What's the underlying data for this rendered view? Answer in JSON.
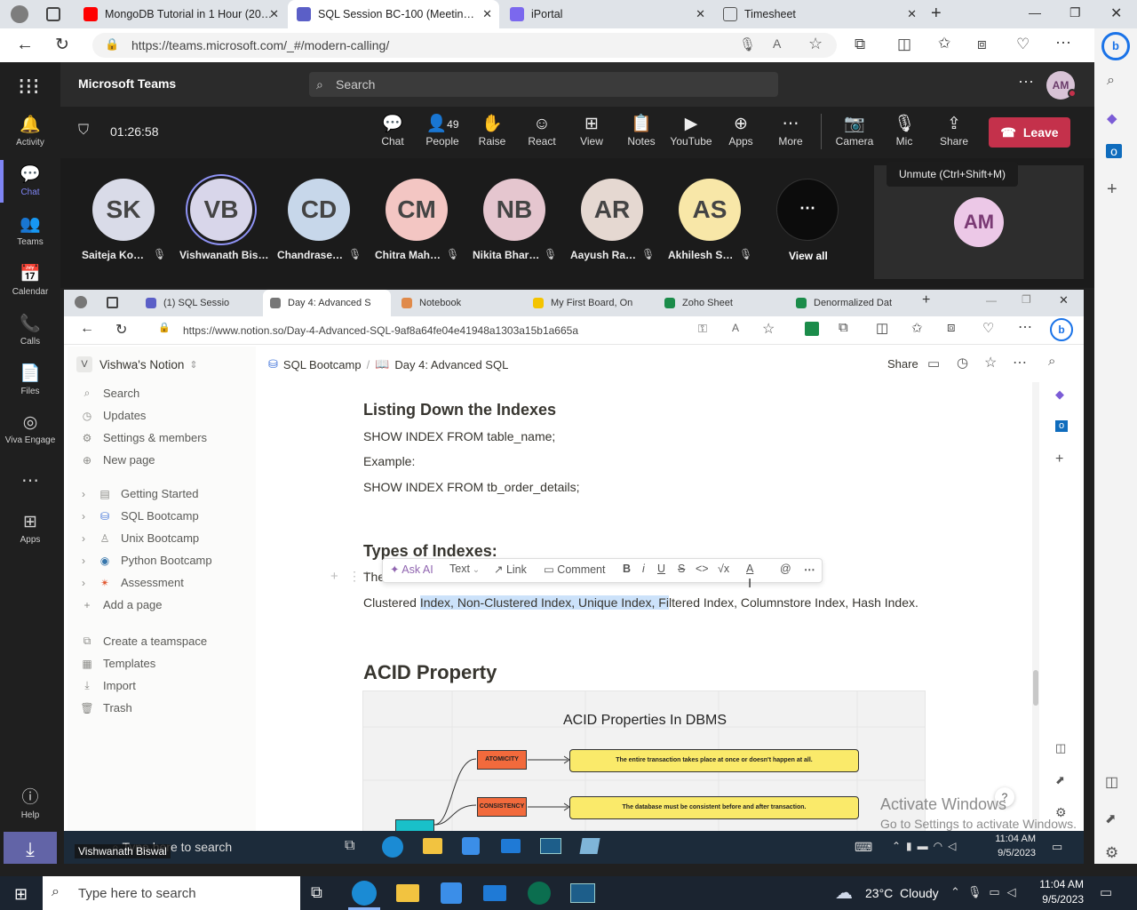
{
  "outer_browser": {
    "tabs": [
      {
        "title": "MongoDB Tutorial in 1 Hour (20…",
        "icon": "youtube-icon",
        "color": "#ff0000"
      },
      {
        "title": "SQL Session BC-100 (Meetin…",
        "icon": "teams-icon",
        "color": "#5b5fc7"
      },
      {
        "title": "iPortal",
        "icon": "portal-icon",
        "color": "#7b68ee"
      },
      {
        "title": "Timesheet",
        "icon": "page-icon",
        "color": "#666666"
      }
    ],
    "url": "https://teams.microsoft.com/_#/modern-calling/"
  },
  "teams": {
    "app_name": "Microsoft Teams",
    "search_placeholder": "Search",
    "avatar": "AM",
    "rail": [
      {
        "label": "Activity",
        "icon": "bell-icon"
      },
      {
        "label": "Chat",
        "icon": "chat-icon"
      },
      {
        "label": "Teams",
        "icon": "teams-icon"
      },
      {
        "label": "Calendar",
        "icon": "calendar-icon"
      },
      {
        "label": "Calls",
        "icon": "phone-icon"
      },
      {
        "label": "Files",
        "icon": "file-icon"
      },
      {
        "label": "Viva Engage",
        "icon": "viva-icon"
      },
      {
        "label": "Apps",
        "icon": "apps-icon"
      },
      {
        "label": "Help",
        "icon": "help-icon"
      }
    ],
    "timer": "01:26:58",
    "meeting_buttons": [
      {
        "label": "Chat",
        "icon": "chat-icon",
        "glyph": "💬"
      },
      {
        "label": "People",
        "icon": "people-icon",
        "glyph": "👤",
        "count": "49"
      },
      {
        "label": "Raise",
        "icon": "hand-icon",
        "glyph": "✋"
      },
      {
        "label": "React",
        "icon": "smile-icon",
        "glyph": "☺"
      },
      {
        "label": "View",
        "icon": "grid-icon",
        "glyph": "⊞"
      },
      {
        "label": "Notes",
        "icon": "notes-icon",
        "glyph": "📋"
      },
      {
        "label": "YouTube",
        "icon": "youtube-icon",
        "glyph": "▶"
      },
      {
        "label": "Apps",
        "icon": "plus-icon",
        "glyph": "⊕"
      },
      {
        "label": "More",
        "icon": "more-icon",
        "glyph": "⋯"
      },
      {
        "label": "Camera",
        "icon": "camera-off-icon",
        "glyph": "📷"
      },
      {
        "label": "Mic",
        "icon": "mic-off-icon",
        "glyph": "🎙"
      },
      {
        "label": "Share",
        "icon": "share-icon",
        "glyph": "⇪"
      }
    ],
    "leave_label": "Leave",
    "unmute_tooltip": "Unmute (Ctrl+Shift+M)",
    "participants": [
      {
        "initials": "SK",
        "name": "Saiteja Ko…",
        "color": "#d9dbe8"
      },
      {
        "initials": "VB",
        "name": "Vishwanath Bis…",
        "color": "#d8d6ea"
      },
      {
        "initials": "CD",
        "name": "Chandrase…",
        "color": "#c7d7ea"
      },
      {
        "initials": "CM",
        "name": "Chitra Mah…",
        "color": "#f3c6c3"
      },
      {
        "initials": "NB",
        "name": "Nikita Bhar…",
        "color": "#e5c6cf"
      },
      {
        "initials": "AR",
        "name": "Aayush Ra…",
        "color": "#e5d8d1"
      },
      {
        "initials": "AS",
        "name": "Akhilesh S…",
        "color": "#f8e7a8"
      }
    ],
    "view_all": "View all",
    "self_initials": "AM"
  },
  "inner_browser": {
    "tabs": [
      {
        "title": "(1) SQL Sessio",
        "color": "#5b5fc7"
      },
      {
        "title": "Day 4: Advanced S",
        "color": "#777777"
      },
      {
        "title": "Notebook",
        "color": "#e08a4a"
      },
      {
        "title": "My First Board, On",
        "color": "#f4c400"
      },
      {
        "title": "Zoho Sheet",
        "color": "#1b8c4a"
      },
      {
        "title": "Denormalized Dat",
        "color": "#1b8c4a"
      }
    ],
    "url": "https://www.notion.so/Day-4-Advanced-SQL-9af8a64fe04e41948a1303a15b1a665a"
  },
  "notion": {
    "workspace_initial": "V",
    "workspace": "Vishwa's Notion",
    "nav": [
      {
        "label": "Search",
        "icon": "search-icon",
        "glyph": "⌕"
      },
      {
        "label": "Updates",
        "icon": "clock-icon",
        "glyph": "◷"
      },
      {
        "label": "Settings & members",
        "icon": "gear-icon",
        "glyph": "⚙"
      },
      {
        "label": "New page",
        "icon": "plus-circle-icon",
        "glyph": "⊕"
      }
    ],
    "pages": [
      {
        "label": "Getting Started",
        "icon": "page-icon",
        "glyph": "▤"
      },
      {
        "label": "SQL Bootcamp",
        "icon": "database-icon",
        "glyph": "🛢"
      },
      {
        "label": "Unix Bootcamp",
        "icon": "penguin-icon",
        "glyph": "🐧"
      },
      {
        "label": "Python Bootcamp",
        "icon": "python-icon",
        "glyph": "🐍"
      },
      {
        "label": "Assessment",
        "icon": "star-icon",
        "glyph": "✴"
      }
    ],
    "add_page": "Add a page",
    "bottom": [
      {
        "label": "Create a teamspace",
        "icon": "team-icon",
        "glyph": "⧉"
      },
      {
        "label": "Templates",
        "icon": "template-icon",
        "glyph": "▦"
      },
      {
        "label": "Import",
        "icon": "import-icon",
        "glyph": "⤓"
      },
      {
        "label": "Trash",
        "icon": "trash-icon",
        "glyph": "🗑"
      }
    ],
    "breadcrumb": [
      "SQL Bootcamp",
      "Day 4: Advanced SQL"
    ],
    "share": "Share",
    "content": {
      "h_listing": "Listing Down the Indexes",
      "line1": "SHOW INDEX FROM table_name;",
      "example": "Example:",
      "line2": "SHOW INDEX FROM tb_order_details;",
      "h_types": "Types of Indexes:",
      "the_prefix": "The",
      "types_pre": "Clustered ",
      "types_sel": "Index, Non-Clustered Index, Unique Index, Fi",
      "types_post": "ltered Index, Columnstore Index, Hash Index.",
      "h_acid": "ACID Property"
    },
    "toolbar": {
      "ask_ai": "Ask AI",
      "text": "Text",
      "link": "Link",
      "comment": "Comment"
    },
    "diagram": {
      "title": "ACID Properties In DBMS",
      "rows": [
        {
          "label": "ATOMICITY",
          "desc": "The entire transaction takes place at once or doesn't happen at all."
        },
        {
          "label": "CONSISTENCY",
          "desc": "The database must be consistent before and after transaction."
        }
      ]
    }
  },
  "watermark": {
    "line1": "Activate Windows",
    "line2": "Go to Settings to activate Windows."
  },
  "inner_taskbar": {
    "search": "Type here to search",
    "time": "11:04 AM",
    "date": "9/5/2023",
    "tooltip": "Vishwanath Biswal"
  },
  "taskbar": {
    "search": "Type here to search",
    "weather": "23°C  Cloudy",
    "time": "11:04 AM",
    "date": "9/5/2023"
  }
}
